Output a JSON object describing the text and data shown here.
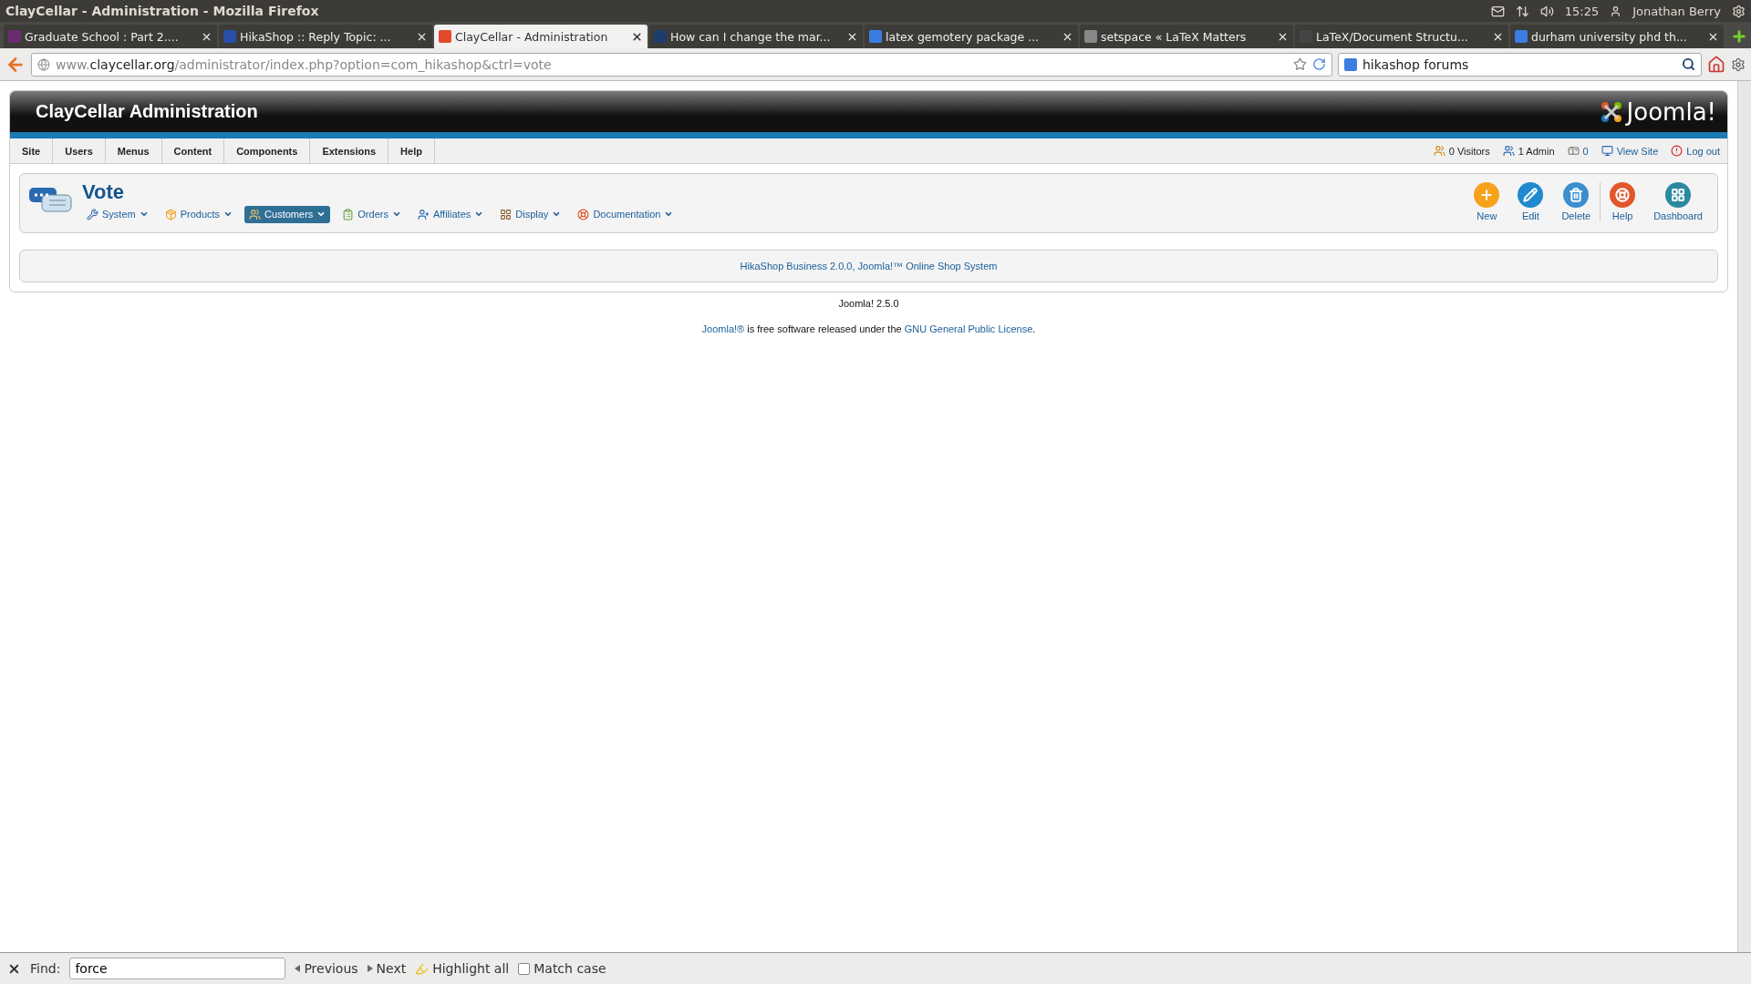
{
  "window": {
    "title": "ClayCellar - Administration - Mozilla Firefox"
  },
  "system_tray": {
    "time": "15:25",
    "user": "Jonathan Berry"
  },
  "tabs": [
    {
      "label": "Graduate School : Part 2....",
      "selected": false,
      "color": "#6a2c70"
    },
    {
      "label": "HikaShop :: Reply Topic: ...",
      "selected": false,
      "color": "#2a4fa8"
    },
    {
      "label": "ClayCellar - Administration",
      "selected": true,
      "color": "#e24a2c"
    },
    {
      "label": "How can I change the mar...",
      "selected": false,
      "color": "#1d3d6b"
    },
    {
      "label": "latex gemotery package ...",
      "selected": false,
      "color": "#3b7de0"
    },
    {
      "label": "setspace « LaTeX Matters",
      "selected": false,
      "color": "#888888"
    },
    {
      "label": "LaTeX/Document Structu...",
      "selected": false,
      "color": "#444444"
    },
    {
      "label": "durham university phd th...",
      "selected": false,
      "color": "#3b7de0"
    }
  ],
  "address_bar": {
    "host_prefix": "www.",
    "host": "claycellar.org",
    "path": "/administrator/index.php?option=com_hikashop&ctrl=vote"
  },
  "search_bar": {
    "value": "hikashop forums"
  },
  "admin_header": {
    "title": "ClayCellar Administration",
    "logo": "Joomla!"
  },
  "main_menu": [
    "Site",
    "Users",
    "Menus",
    "Content",
    "Components",
    "Extensions",
    "Help"
  ],
  "status": [
    {
      "kind": "visitors",
      "label": "0 Visitors"
    },
    {
      "kind": "admins",
      "label": "1 Admin"
    },
    {
      "kind": "messages",
      "label": "0"
    },
    {
      "kind": "link",
      "label": "View Site"
    },
    {
      "kind": "logout",
      "label": "Log out"
    }
  ],
  "page_title": "Vote",
  "submenu": [
    {
      "label": "System",
      "selected": false
    },
    {
      "label": "Products",
      "selected": false
    },
    {
      "label": "Customers",
      "selected": true
    },
    {
      "label": "Orders",
      "selected": false
    },
    {
      "label": "Affiliates",
      "selected": false
    },
    {
      "label": "Display",
      "selected": false
    },
    {
      "label": "Documentation",
      "selected": false
    }
  ],
  "toolbar": [
    {
      "kind": "new",
      "label": "New"
    },
    {
      "kind": "edit",
      "label": "Edit"
    },
    {
      "kind": "delete",
      "label": "Delete"
    },
    {
      "kind": "help",
      "label": "Help"
    },
    {
      "kind": "dashboard",
      "label": "Dashboard"
    }
  ],
  "credit": "HikaShop Business 2.0.0, Joomla!™ Online Shop System",
  "version": "Joomla! 2.5.0",
  "license": {
    "link": "Joomla!®",
    "text": " is free software released under the ",
    "license_link": "GNU General Public License",
    "end": "."
  },
  "find_bar": {
    "label": "Find:",
    "value": "force",
    "previous": "Previous",
    "next": "Next",
    "highlight": "Highlight all",
    "match_case": {
      "label": "Match case",
      "checked": false
    }
  }
}
